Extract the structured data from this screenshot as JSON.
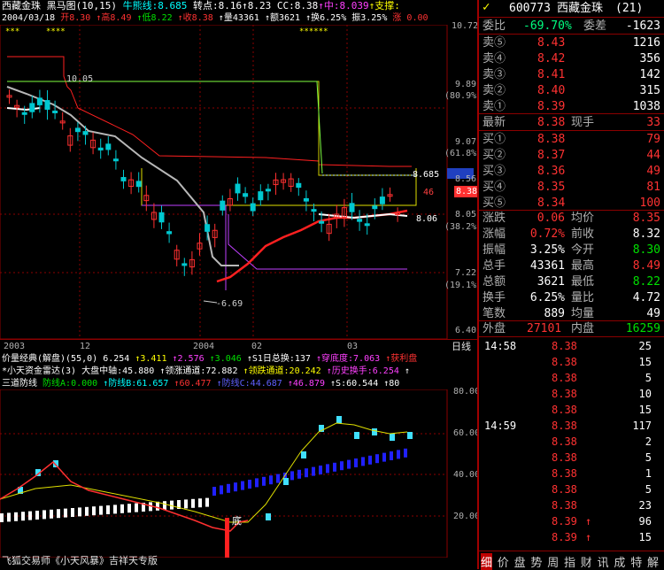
{
  "header": {
    "stock_name": "西藏金珠",
    "chart_title": "黑马图(10,15)",
    "indicator1": "牛熊线:8.685",
    "indicator2": "转点:8.16",
    "indicator3": "↑8.23",
    "indicator4": "CC:8.38",
    "indicator5": "↑中:8.039",
    "indicator6": "↑支撑:",
    "date": "2004/03/18",
    "open": "开8.30",
    "high": "↑高8.49",
    "low": "↑低8.22",
    "close": "↑收8.38",
    "volume": "↑量43361",
    "amount": "↑额3621",
    "turnover": "↑换6.25%",
    "amplitude": "振3.25%",
    "rise": "涨",
    "rise_val": "0.00"
  },
  "price_axis": [
    "10.72",
    "9.89",
    "(80.9%)",
    "9.07",
    "(61.8%)",
    "8.56",
    "8.05",
    "(38.2%)",
    "7.22",
    "(19.1%)",
    "6.40"
  ],
  "price_labels": {
    "p1005": "10.05",
    "p669": "-6.69",
    "p8685": "8.685",
    "p838": "8.38",
    "p846": "46",
    "p806": "8.06"
  },
  "date_axis": [
    "2003",
    "12",
    "2004",
    "02",
    "03"
  ],
  "date_axis_right": "日线",
  "panel2": {
    "line1": [
      "价量经典(解盘)(55,0)",
      "6.254",
      "↑3.411",
      "↑2.576",
      "↑3.046",
      "↑S1日总换:137",
      "↑穿底度:7.063",
      "↑获利盘"
    ],
    "line2": [
      "*小天资金雷达(3)",
      "大盘中轴:45.880",
      "↑领涨通道:72.882",
      "↑领跌通道:20.242",
      "↑历史换手:6.254",
      "↑"
    ],
    "line3": [
      "三道防线",
      "防线A:0.000",
      "↑防线B:61.657",
      "↑60.477",
      "↑防线C:44.687",
      "↑46.879",
      "↑S:60.544",
      "↑80"
    ]
  },
  "osc_axis": [
    "80.00",
    "60.00",
    "40.00",
    "20.00"
  ],
  "osc_label": "底",
  "bottom_text": "飞狐交易师《小天风暴》吉祥天专版",
  "right": {
    "code": "600773",
    "name": "西藏金珠",
    "num": "(21)",
    "weibi_label": "委比",
    "weibi_val": "-69.70%",
    "weicha_label": "委差",
    "weicha_val": "-1623",
    "sell": [
      {
        "label": "卖⑤",
        "price": "8.43",
        "vol": "1216"
      },
      {
        "label": "卖④",
        "price": "8.42",
        "vol": "356"
      },
      {
        "label": "卖③",
        "price": "8.41",
        "vol": "142"
      },
      {
        "label": "卖②",
        "price": "8.40",
        "vol": "315"
      },
      {
        "label": "卖①",
        "price": "8.39",
        "vol": "1038"
      }
    ],
    "latest": {
      "label": "最新",
      "price": "8.38",
      "label2": "现手",
      "vol": "33"
    },
    "buy": [
      {
        "label": "买①",
        "price": "8.38",
        "vol": "79"
      },
      {
        "label": "买②",
        "price": "8.37",
        "vol": "44"
      },
      {
        "label": "买③",
        "price": "8.36",
        "vol": "49"
      },
      {
        "label": "买④",
        "price": "8.35",
        "vol": "81"
      },
      {
        "label": "买⑤",
        "price": "8.34",
        "vol": "100"
      }
    ],
    "stats": [
      {
        "l1": "涨跌",
        "v1": "0.06",
        "l2": "均价",
        "v2": "8.35",
        "c1": "red",
        "c2": "red"
      },
      {
        "l1": "涨幅",
        "v1": "0.72%",
        "l2": "前收",
        "v2": "8.32",
        "c1": "red",
        "c2": "wht"
      },
      {
        "l1": "振幅",
        "v1": "3.25%",
        "l2": "今开",
        "v2": "8.30",
        "c1": "wht",
        "c2": "grn"
      },
      {
        "l1": "总手",
        "v1": "43361",
        "l2": "最高",
        "v2": "8.49",
        "c1": "wht",
        "c2": "red"
      },
      {
        "l1": "总额",
        "v1": "3621",
        "l2": "最低",
        "v2": "8.22",
        "c1": "wht",
        "c2": "grn"
      },
      {
        "l1": "换手",
        "v1": "6.25%",
        "l2": "量比",
        "v2": "4.72",
        "c1": "wht",
        "c2": "wht"
      },
      {
        "l1": "笔数",
        "v1": "889",
        "l2": "均量",
        "v2": "49",
        "c1": "wht",
        "c2": "wht"
      }
    ],
    "outer": {
      "l1": "外盘",
      "v1": "27101",
      "l2": "内盘",
      "v2": "16259"
    },
    "tape": [
      {
        "t": "14:58",
        "p": "8.38",
        "v": "25"
      },
      {
        "t": "",
        "p": "8.38",
        "v": "15"
      },
      {
        "t": "",
        "p": "8.38",
        "v": "5"
      },
      {
        "t": "",
        "p": "8.38",
        "v": "10"
      },
      {
        "t": "",
        "p": "8.38",
        "v": "15"
      },
      {
        "t": "14:59",
        "p": "8.38",
        "v": "117"
      },
      {
        "t": "",
        "p": "8.38",
        "v": "2"
      },
      {
        "t": "",
        "p": "8.38",
        "v": "5"
      },
      {
        "t": "",
        "p": "8.38",
        "v": "1"
      },
      {
        "t": "",
        "p": "8.38",
        "v": "5"
      },
      {
        "t": "",
        "p": "8.38",
        "v": "23"
      },
      {
        "t": "",
        "p": "8.39",
        "v": "96"
      },
      {
        "t": "",
        "p": "8.39",
        "v": "15"
      }
    ],
    "tabs": [
      "细",
      "价",
      "盘",
      "势",
      "周",
      "指",
      "财",
      "讯",
      "成",
      "特",
      "解"
    ]
  },
  "colors": {
    "up": "#ff3232",
    "down": "#00e000",
    "grid": "#8b0000",
    "cyan": "#00c8d0"
  }
}
